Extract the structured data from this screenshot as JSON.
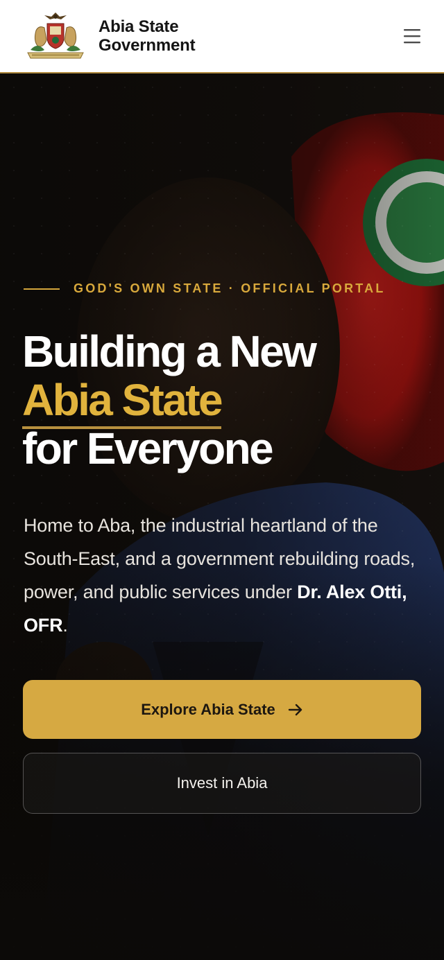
{
  "header": {
    "brand_line1": "Abia State",
    "brand_line2": "Government",
    "crest_icon": "abia-coat-of-arms-icon",
    "menu_icon": "hamburger-menu-icon"
  },
  "hero": {
    "eyebrow": "GOD'S OWN STATE · OFFICIAL PORTAL",
    "headline_line1": "Building a New",
    "headline_accent": "Abia State",
    "headline_line3": "for Everyone",
    "lead_text": "Home to Aba, the industrial heartland of the South-East, and a government rebuilding roads, power, and public services under ",
    "lead_strong": "Dr. Alex Otti, OFR",
    "lead_end": ".",
    "primary_cta": "Explore Abia State",
    "primary_cta_icon": "arrow-right-icon",
    "secondary_cta": "Invest in Abia"
  },
  "colors": {
    "accent_gold": "#d6a942",
    "eyebrow_gold": "#d9a93c",
    "header_bg": "#ffffff",
    "hero_bg": "#0f0d0b"
  }
}
